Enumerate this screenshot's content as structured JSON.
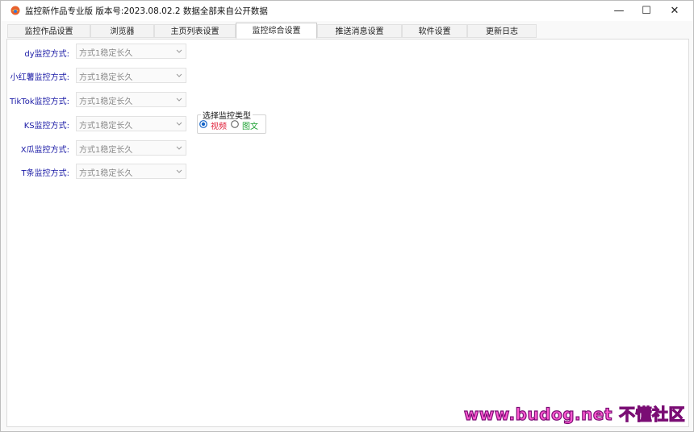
{
  "window": {
    "title": "监控新作品专业版 版本号:2023.08.02.2  数据全部来自公开数据",
    "controls": {
      "minimize": "—",
      "maximize": "☐",
      "close": "✕"
    }
  },
  "tabs": [
    {
      "label": "监控作品设置"
    },
    {
      "label": "浏览器"
    },
    {
      "label": "主页列表设置"
    },
    {
      "label": "监控综合设置",
      "active": true
    },
    {
      "label": "推送消息设置"
    },
    {
      "label": "软件设置"
    },
    {
      "label": "更新日志"
    }
  ],
  "monitor_methods": [
    {
      "label": "dy监控方式:",
      "value": "方式1稳定长久"
    },
    {
      "label": "小红薯监控方式:",
      "value": "方式1稳定长久"
    },
    {
      "label": "TikTok监控方式:",
      "value": "方式1稳定长久"
    },
    {
      "label": "KS监控方式:",
      "value": "方式1稳定长久"
    },
    {
      "label": "X瓜监控方式:",
      "value": "方式1稳定长久"
    },
    {
      "label": "T条监控方式:",
      "value": "方式1稳定长久"
    }
  ],
  "monitor_type": {
    "title": "选择监控类型",
    "options": [
      {
        "label": "视频",
        "selected": true,
        "color": "#e0203a"
      },
      {
        "label": "图文",
        "selected": false,
        "color": "#1aa030"
      }
    ]
  },
  "watermark": {
    "url": "www.budog.net",
    "name": "不懂社区"
  },
  "colors": {
    "label_blue": "#1a1aa6",
    "radio_blue": "#1464c8"
  }
}
